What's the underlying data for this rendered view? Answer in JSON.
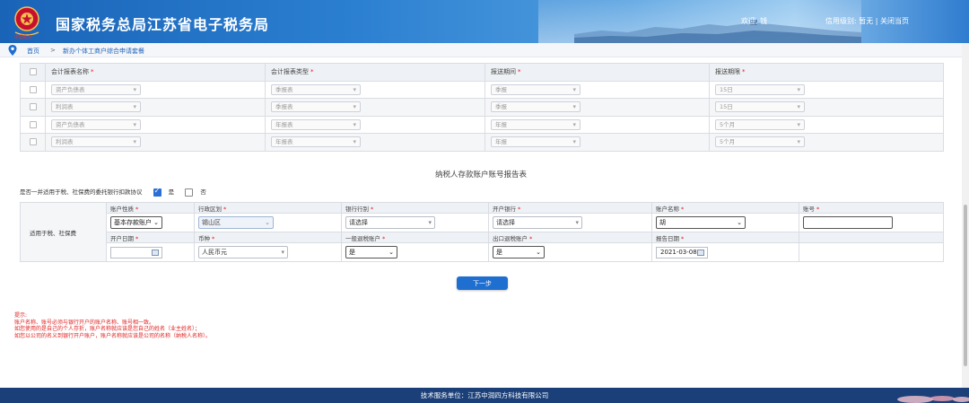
{
  "header": {
    "title": "国家税务总局江苏省电子税务局",
    "user_greeting": "欢迎, 钱",
    "credit_label": "信用级别:",
    "credit_value": "暂无",
    "divider": "|",
    "close_label": "关闭当页"
  },
  "breadcrumb": {
    "home": "首页",
    "separator": ">",
    "current": "新办个体工商户综合申请套餐"
  },
  "report_table": {
    "headers": [
      "会计报表名称",
      "会计报表类型",
      "报送期间",
      "报送期限"
    ],
    "required_mark": "*",
    "rows": [
      {
        "name": "资产负债表",
        "type": "季报表",
        "period": "季报",
        "deadline": "15日"
      },
      {
        "name": "利润表",
        "type": "季报表",
        "period": "季报",
        "deadline": "15日"
      },
      {
        "name": "资产负债表",
        "type": "年报表",
        "period": "年报",
        "deadline": "5个月"
      },
      {
        "name": "利润表",
        "type": "年报表",
        "period": "年报",
        "deadline": "5个月"
      }
    ]
  },
  "account_section": {
    "title": "纳税人存款账户账号报告表",
    "agreement_question": "是否一并适用于税、社保费的委托银行扣款协议",
    "yes_label": "是",
    "no_label": "否",
    "yes_checked": true,
    "side_label": "适用于税、社保费",
    "row1_headers": [
      "账户性质",
      "行政区划",
      "银行行别",
      "开户银行",
      "账户名称",
      "账号"
    ],
    "row1_values": {
      "account_nature": "基本存款账户",
      "region": "锡山区",
      "bank_type": "请选择",
      "open_bank": "请选择",
      "account_name": "胡",
      "account_no": ""
    },
    "row2_headers": [
      "开户日期",
      "币种",
      "一般退税账户",
      "出口退税账户",
      "报告日期"
    ],
    "row2_values": {
      "open_date": "",
      "currency": "人民币元",
      "general_refund": "是",
      "export_refund": "是",
      "report_date": "2021-03-08"
    }
  },
  "next_button": "下一步",
  "tips": {
    "heading": "提示:",
    "lines": [
      "账户名称、账号必须与银行开户的账户名称、账号相一致。",
      "如您使用的是自己的个人存折，账户名称就应该是您自己的姓名（业主姓名）；",
      "如您以公司的名义到银行开户账户，账户名称就应该是公司的名称（纳税人名称）。"
    ]
  },
  "footer": {
    "text": "技术服务单位：江苏中润四方科技有限公司"
  },
  "colors": {
    "header_blue": "#1a64b8",
    "button_blue": "#1f6fd1",
    "required_red": "#e02020",
    "footer_navy": "#1b3f78"
  }
}
